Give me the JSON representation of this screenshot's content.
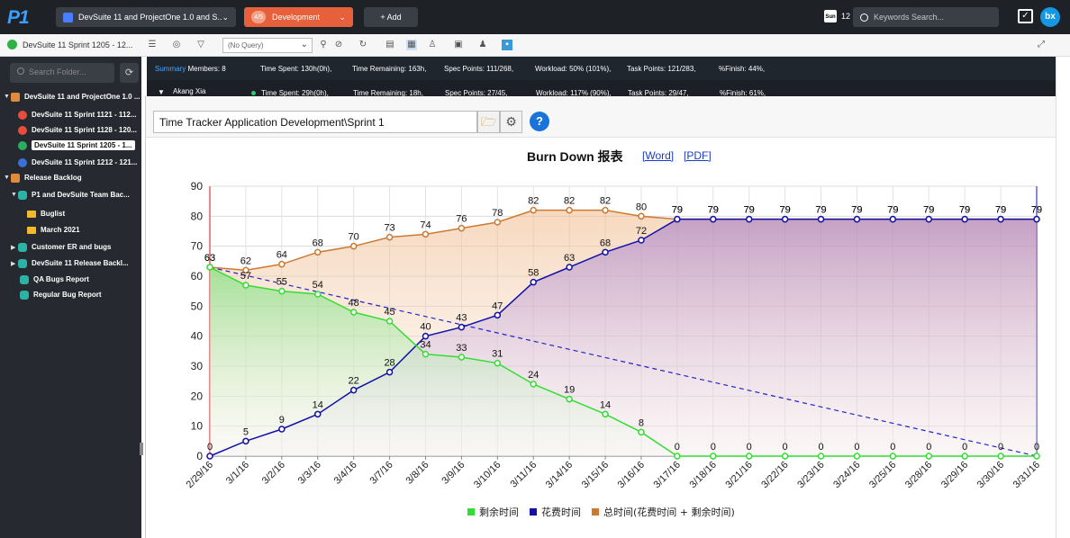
{
  "app": {
    "logo": "P1"
  },
  "topbar": {
    "project": "DevSuite 11 and ProjectOne 1.0 and S...",
    "stage_badge": "4/5",
    "stage": "Development",
    "add_label": "+  Add",
    "calendar_icon": "calendar-icon",
    "calendar_count": "12",
    "search_placeholder": "Keywords Search...",
    "avatar": "bx"
  },
  "toolbar": {
    "sprint": "DevSuite 11 Sprint 1205 - 12...",
    "query": "(No Query)"
  },
  "sidebar": {
    "search_placeholder": "Search Folder...",
    "items": [
      {
        "label": "DevSuite 11 and ProjectOne 1.0 ..."
      },
      {
        "label": "DevSuite 11 Sprint 1121 - 112..."
      },
      {
        "label": "DevSuite 11 Sprint 1128 - 120..."
      },
      {
        "label": "DevSuite 11 Sprint 1205 - 1..."
      },
      {
        "label": "DevSuite 11 Sprint 1212 - 121..."
      },
      {
        "label": "Release Backlog"
      },
      {
        "label": "P1 and DevSuite Team Bac..."
      },
      {
        "label": "Buglist"
      },
      {
        "label": "March 2021"
      },
      {
        "label": "Customer ER and bugs"
      },
      {
        "label": "DevSuite 11 Release Backl..."
      },
      {
        "label": "QA Bugs Report"
      },
      {
        "label": "Regular Bug Report"
      }
    ]
  },
  "summary": {
    "label": "Summary",
    "members": "Members: 8",
    "time_spent": "Time Spent: 130h(0h),",
    "time_remaining": "Time Remaining: 163h,",
    "spec_points": "Spec Points: 111/268,",
    "workload": "Workload: 50% (101%),",
    "task_points": "Task Points: 121/283,",
    "finish": "%Finish: 44%,"
  },
  "member": {
    "name": "Akang Xia",
    "time_spent": "Time Spent: 29h(0h),",
    "time_remaining": "Time Remaining: 18h,",
    "spec_points": "Spec Points: 27/45,",
    "workload": "Workload: 117% (90%),",
    "task_points": "Task Points: 29/47,",
    "finish": "%Finish: 61%,"
  },
  "report": {
    "path": "Time Tracker Application Development\\Sprint 1",
    "title": "Burn Down 报表",
    "word_link": "[Word]",
    "pdf_link": "[PDF]"
  },
  "colors": {
    "remaining": "#33dd33",
    "spent": "#1111aa",
    "total": "#cc7a33",
    "ideal": "#2222cc"
  },
  "chart_data": {
    "type": "line",
    "categories": [
      "2/29/16",
      "3/1/16",
      "3/2/16",
      "3/3/16",
      "3/4/16",
      "3/7/16",
      "3/8/16",
      "3/9/16",
      "3/10/16",
      "3/11/16",
      "3/14/16",
      "3/15/16",
      "3/16/16",
      "3/17/16",
      "3/18/16",
      "3/21/16",
      "3/22/16",
      "3/23/16",
      "3/24/16",
      "3/25/16",
      "3/28/16",
      "3/29/16",
      "3/30/16",
      "3/31/16"
    ],
    "ylim": [
      0,
      90
    ],
    "yticks": [
      0,
      10,
      20,
      30,
      40,
      50,
      60,
      70,
      80,
      90
    ],
    "grid": true,
    "legend_position": "bottom",
    "series": [
      {
        "name": "剩余时间",
        "values": [
          63,
          57,
          55,
          54,
          48,
          45,
          34,
          33,
          31,
          24,
          19,
          14,
          8,
          0,
          0,
          0,
          0,
          0,
          0,
          0,
          0,
          0,
          0,
          0
        ]
      },
      {
        "name": "花费时间",
        "values": [
          0,
          5,
          9,
          14,
          22,
          28,
          40,
          43,
          47,
          58,
          63,
          68,
          72,
          79,
          79,
          79,
          79,
          79,
          79,
          79,
          79,
          79,
          79,
          79
        ]
      },
      {
        "name": "总时间(花费时间 + 剩余时间)",
        "values": [
          63,
          62,
          64,
          68,
          70,
          73,
          74,
          76,
          78,
          82,
          82,
          82,
          80,
          79,
          79,
          79,
          79,
          79,
          79,
          79,
          79,
          79,
          79,
          79
        ]
      }
    ],
    "ideal_line": {
      "from": 63,
      "to": 0
    }
  }
}
